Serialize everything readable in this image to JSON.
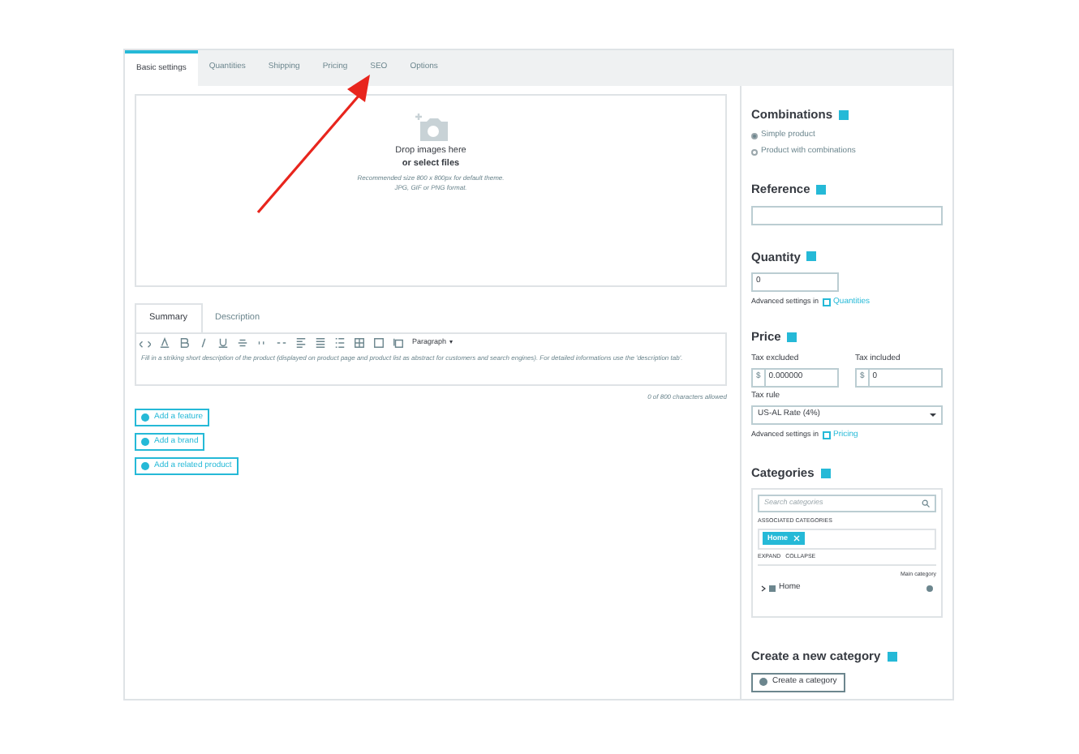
{
  "tabs": [
    {
      "label": "Basic settings",
      "selected": true
    },
    {
      "label": "Quantities",
      "selected": false
    },
    {
      "label": "Shipping",
      "selected": false
    },
    {
      "label": "Pricing",
      "selected": false
    },
    {
      "label": "SEO",
      "selected": false
    },
    {
      "label": "Options",
      "selected": false
    }
  ],
  "dropzone": {
    "title": "Drop images here",
    "link": "or select files",
    "hint1": "Recommended size 800 x 800px for default theme.",
    "hint2": "JPG, GIF or PNG format."
  },
  "editor": {
    "tabs": [
      {
        "label": "Summary",
        "selected": true
      },
      {
        "label": "Description",
        "selected": false
      }
    ],
    "format": "Paragraph",
    "placeholder": "Fill in a striking short description of the product (displayed on product page and product list as abstract for customers and search engines). For detailed informations use the 'description tab'.",
    "counter": "0 of 800 characters allowed"
  },
  "add_buttons": [
    "Add a feature",
    "Add a brand",
    "Add a related product"
  ],
  "combinations": {
    "title": "Combinations",
    "options": [
      {
        "label": "Simple product",
        "selected": true
      },
      {
        "label": "Product with combinations",
        "selected": false
      }
    ]
  },
  "reference": {
    "title": "Reference"
  },
  "quantity": {
    "title": "Quantity",
    "value": "0",
    "advanced": "Advanced settings in",
    "link": "Quantities"
  },
  "price": {
    "title": "Price",
    "excl_label": "Tax excluded",
    "excl_currency": "$",
    "excl_value": "0.000000",
    "incl_label": "Tax included",
    "incl_currency": "$",
    "incl_value": "0",
    "rule_label": "Tax rule",
    "rule_value": "US-AL Rate (4%)",
    "advanced": "Advanced settings in",
    "link": "Pricing"
  },
  "categories": {
    "title": "Categories",
    "search_placeholder": "Search categories",
    "associated_label": "ASSOCIATED CATEGORIES",
    "tags": [
      "Home"
    ],
    "expand": "EXPAND",
    "collapse": "COLLAPSE",
    "main_label": "Main category",
    "tree": [
      {
        "label": "Home",
        "checked": true,
        "main": true
      }
    ]
  },
  "new_category": {
    "title": "Create a new category",
    "button": "Create a category"
  }
}
